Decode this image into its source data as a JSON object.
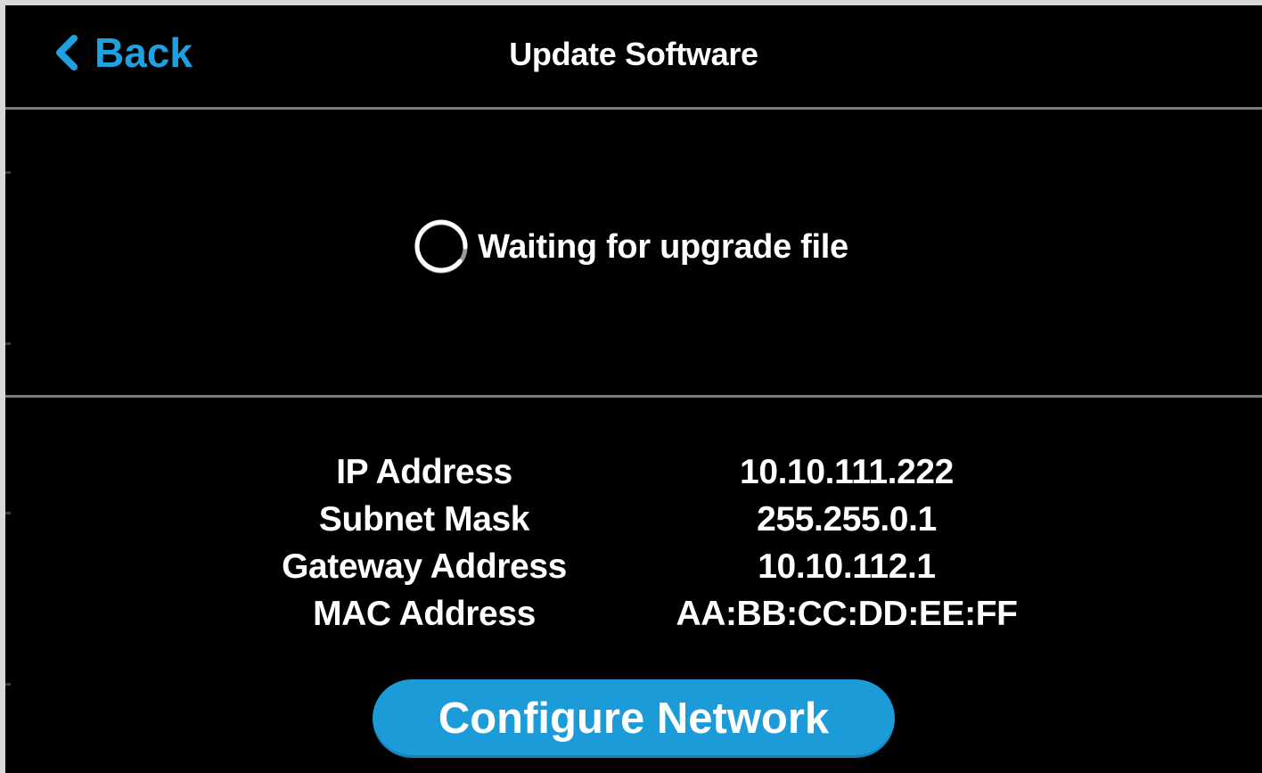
{
  "header": {
    "back_label": "Back",
    "title": "Update Software"
  },
  "status": {
    "text": "Waiting for upgrade file",
    "icon": "loading-spinner-icon"
  },
  "network": {
    "rows": [
      {
        "label": "IP Address",
        "value": "10.10.111.222"
      },
      {
        "label": "Subnet Mask",
        "value": "255.255.0.1"
      },
      {
        "label": "Gateway Address",
        "value": "10.10.112.1"
      },
      {
        "label": "MAC Address",
        "value": "AA:BB:CC:DD:EE:FF"
      }
    ]
  },
  "actions": {
    "configure_label": "Configure Network"
  },
  "colors": {
    "accent": "#1ea1e0",
    "button": "#1b9bd8",
    "background": "#000000",
    "divider": "#7a7a7a"
  }
}
